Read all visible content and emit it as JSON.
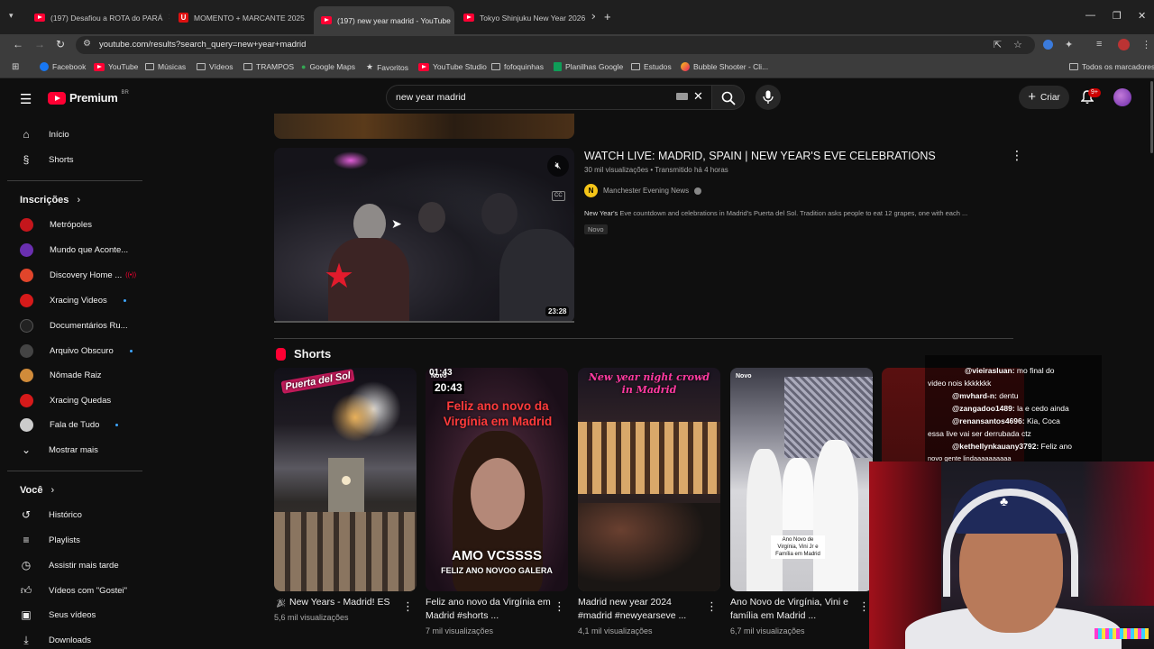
{
  "browser": {
    "tabs": [
      {
        "title": "(197) Desafiou a ROTA do PARÁ",
        "icon": "youtube-icon"
      },
      {
        "title": "MOMENTO + MARCANTE 2025",
        "icon": "u-icon"
      },
      {
        "title": "(197) new year madrid - YouTube",
        "icon": "youtube-icon"
      },
      {
        "title": "Tokyo Shinjuku New Year 2026",
        "icon": "youtube-icon"
      }
    ],
    "url": "youtube.com/results?search_query=new+year+madrid",
    "bookmarks": [
      {
        "label": "Facebook"
      },
      {
        "label": "YouTube"
      },
      {
        "label": "Músicas"
      },
      {
        "label": "Vídeos"
      },
      {
        "label": "TRAMPOS"
      },
      {
        "label": "Google Maps"
      },
      {
        "label": "Favoritos"
      },
      {
        "label": "YouTube Studio"
      },
      {
        "label": "fofoquinhas"
      },
      {
        "label": "Planilhas Google"
      },
      {
        "label": "Estudos"
      },
      {
        "label": "Bubble Shooter - Cli..."
      }
    ],
    "all_bookmarks": "Todos os marcadores"
  },
  "header": {
    "logo": "Premium",
    "country": "BR",
    "search_value": "new year madrid",
    "create_label": "Criar",
    "notif_count": "9+"
  },
  "sidebar": {
    "main": [
      {
        "label": "Início",
        "icon": "home-icon"
      },
      {
        "label": "Shorts",
        "icon": "shorts-icon"
      }
    ],
    "subs_title": "Inscrições",
    "subs": [
      {
        "label": "Metrópoles",
        "color": "#c4161c",
        "dot": false
      },
      {
        "label": "Mundo que Aconte...",
        "color": "#6a2fb0",
        "dot": false
      },
      {
        "label": "Discovery Home ...",
        "color": "#e0452b",
        "dot": false,
        "live": "((•))"
      },
      {
        "label": "Xracing Videos",
        "color": "#d61a1a",
        "dot": true
      },
      {
        "label": "Documentários Ru...",
        "color": "#222222",
        "dot": false
      },
      {
        "label": "Arquivo Obscuro",
        "color": "#444444",
        "dot": true
      },
      {
        "label": "Nômade Raiz",
        "color": "#d08b3a",
        "dot": false
      },
      {
        "label": "Xracing Quedas",
        "color": "#d61a1a",
        "dot": false
      },
      {
        "label": "Fala de Tudo",
        "color": "#cccccc",
        "dot": true
      }
    ],
    "more": "Mostrar mais",
    "you_title": "Você",
    "you": [
      {
        "label": "Histórico",
        "icon": "history-icon"
      },
      {
        "label": "Playlists",
        "icon": "playlists-icon"
      },
      {
        "label": "Assistir mais tarde",
        "icon": "watch-later-icon"
      },
      {
        "label": "Vídeos com \"Gostei\"",
        "icon": "like-icon"
      },
      {
        "label": "Seus vídeos",
        "icon": "your-videos-icon"
      },
      {
        "label": "Downloads",
        "icon": "download-icon"
      }
    ]
  },
  "video": {
    "title": "WATCH LIVE: MADRID, SPAIN | NEW YEAR'S EVE CELEBRATIONS",
    "meta": "30 mil visualizações • Transmitido há 4 horas",
    "channel": "Manchester Evening News",
    "channel_initial": "N",
    "desc_bold": "New Year's",
    "desc": " Eve countdown and celebrations in Madrid's Puerta del Sol. Tradition asks people to eat 12 grapes, one with each ...",
    "badge": "Novo",
    "duration": "23:28",
    "cc": "CC"
  },
  "shorts": {
    "title": "Shorts",
    "items": [
      {
        "title": "New Years - Madrid! ES",
        "views": "5,6 mil visualizações",
        "overlay": "Puerta del Sol"
      },
      {
        "title": "Feliz ano novo da Virgínia em Madrid #shorts ...",
        "views": "7 mil visualizações",
        "overlay": "Feliz ano novo da Virgínia em Madrid",
        "time": "20:43",
        "time2": "01:43",
        "badge": "Novo",
        "bottom1": "AMO VCSSSS",
        "bottom2": "FELIZ ANO NOVOO GALERA"
      },
      {
        "title": "Madrid new year 2024 #madrid #newyearseve ...",
        "views": "4,1 mil visualizações",
        "overlay": "New year night crowd in Madrid"
      },
      {
        "title": "Ano Novo de Virgínia, Vini e família em Madrid ...",
        "views": "6,7 mil visualizações",
        "badge": "Novo",
        "caption": "Ano Novo de Virgínia, Vini Jr e Família em Madrid"
      }
    ]
  },
  "chat": [
    {
      "user": "@vieirasluan:",
      "msg": " mo final do"
    },
    {
      "user": "",
      "msg": "video nois kkkkkkk"
    },
    {
      "user": "@mvhard-n:",
      "msg": " dentu"
    },
    {
      "user": "@zangadoo1489:",
      "msg": " la e cedo ainda"
    },
    {
      "user": "@renansantos4696:",
      "msg": " Kia, Coca"
    },
    {
      "user": "",
      "msg": "essa live vai ser derrubada ctz"
    },
    {
      "user": "@kethellynkauany3792:",
      "msg": " Feliz ano"
    },
    {
      "user": "",
      "msg": "novo gente lindaaaaaaaaaa"
    }
  ]
}
